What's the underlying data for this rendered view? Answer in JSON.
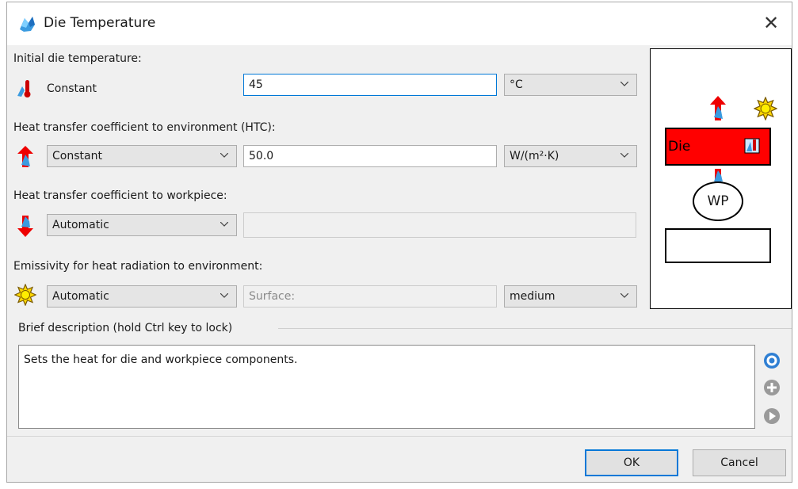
{
  "window": {
    "title": "Die Temperature",
    "close_glyph": "✕"
  },
  "initial_temp": {
    "label": "Initial die temperature:",
    "mode_text": "Constant",
    "value": "45",
    "unit": "°C"
  },
  "htc_env": {
    "label": "Heat transfer coefficient to environment (HTC):",
    "mode": "Constant",
    "value": "50.0",
    "unit": "W/(m²·K)"
  },
  "htc_wp": {
    "label": "Heat transfer coefficient to workpiece:",
    "mode": "Automatic",
    "value": ""
  },
  "emissivity": {
    "label": "Emissivity for heat radiation to environment:",
    "mode": "Automatic",
    "surface_placeholder": "Surface:",
    "level": "medium"
  },
  "preview": {
    "die_label": "Die",
    "wp_label": "WP"
  },
  "description": {
    "label": "Brief description (hold Ctrl key to lock)",
    "text": "Sets the heat for die and workpiece components."
  },
  "buttons": {
    "ok": "OK",
    "cancel": "Cancel"
  },
  "icons": {
    "title": "crystal-die-icon",
    "temp": "thermometer-icon",
    "htc_env": "heat-up-arrow-icon",
    "htc_wp": "heat-down-arrow-icon",
    "emissivity": "sun-icon",
    "side1": "info-icon",
    "side2": "add-icon",
    "side3": "next-icon"
  },
  "colors": {
    "accent": "#0078d7",
    "die": "#ff0000"
  }
}
